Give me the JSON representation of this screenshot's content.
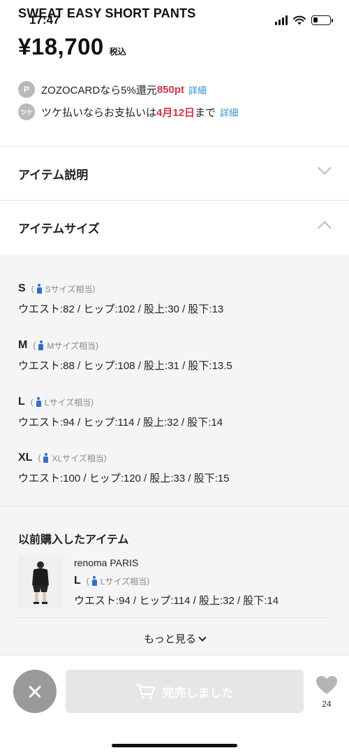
{
  "status_bar": {
    "time": "17:47"
  },
  "product": {
    "title": "SWEAT EASY SHORT PANTS",
    "price": "¥18,700",
    "tax_label": "税込"
  },
  "promos": [
    {
      "badge": "P",
      "prefix": "ZOZOCARDなら5%還元 ",
      "highlight": "850pt",
      "suffix": "",
      "link": "詳細"
    },
    {
      "badge": "ツケ",
      "prefix": "ツケ払いならお支払いは",
      "highlight": "4月12日",
      "suffix": "まで",
      "link": "詳細"
    }
  ],
  "sections": {
    "description": "アイテム説明",
    "size": "アイテムサイズ"
  },
  "sizes": [
    {
      "name": "S",
      "equiv": "Sサイズ相当",
      "detail": "ウエスト:82 / ヒップ:102 / 股上:30 / 股下:13"
    },
    {
      "name": "M",
      "equiv": "Mサイズ相当",
      "detail": "ウエスト:88 / ヒップ:108 / 股上:31 / 股下:13.5"
    },
    {
      "name": "L",
      "equiv": "Lサイズ相当",
      "detail": "ウエスト:94 / ヒップ:114 / 股上:32 / 股下:14"
    },
    {
      "name": "XL",
      "equiv": "XLサイズ相当",
      "detail": "ウエスト:100 / ヒップ:120 / 股上:33 / 股下:15"
    }
  ],
  "previous": {
    "title": "以前購入したアイテム",
    "brand": "renoma PARIS",
    "size": "L",
    "equiv": "Lサイズ相当",
    "detail": "ウエスト:94 / ヒップ:114 / 股上:32 / 股下:14",
    "more": "もっと見る"
  },
  "bottom": {
    "sold_out": "完売しました",
    "fav_count": "24"
  },
  "colors": {
    "accent_red": "#d6344b",
    "link_blue": "#2a8fd6",
    "person_blue": "#2f6fd0"
  },
  "icons": [
    "signal-icon",
    "wifi-icon",
    "battery-icon",
    "chevron-down-icon",
    "chevron-up-icon",
    "person-icon",
    "close-icon",
    "cart-icon",
    "heart-icon"
  ]
}
